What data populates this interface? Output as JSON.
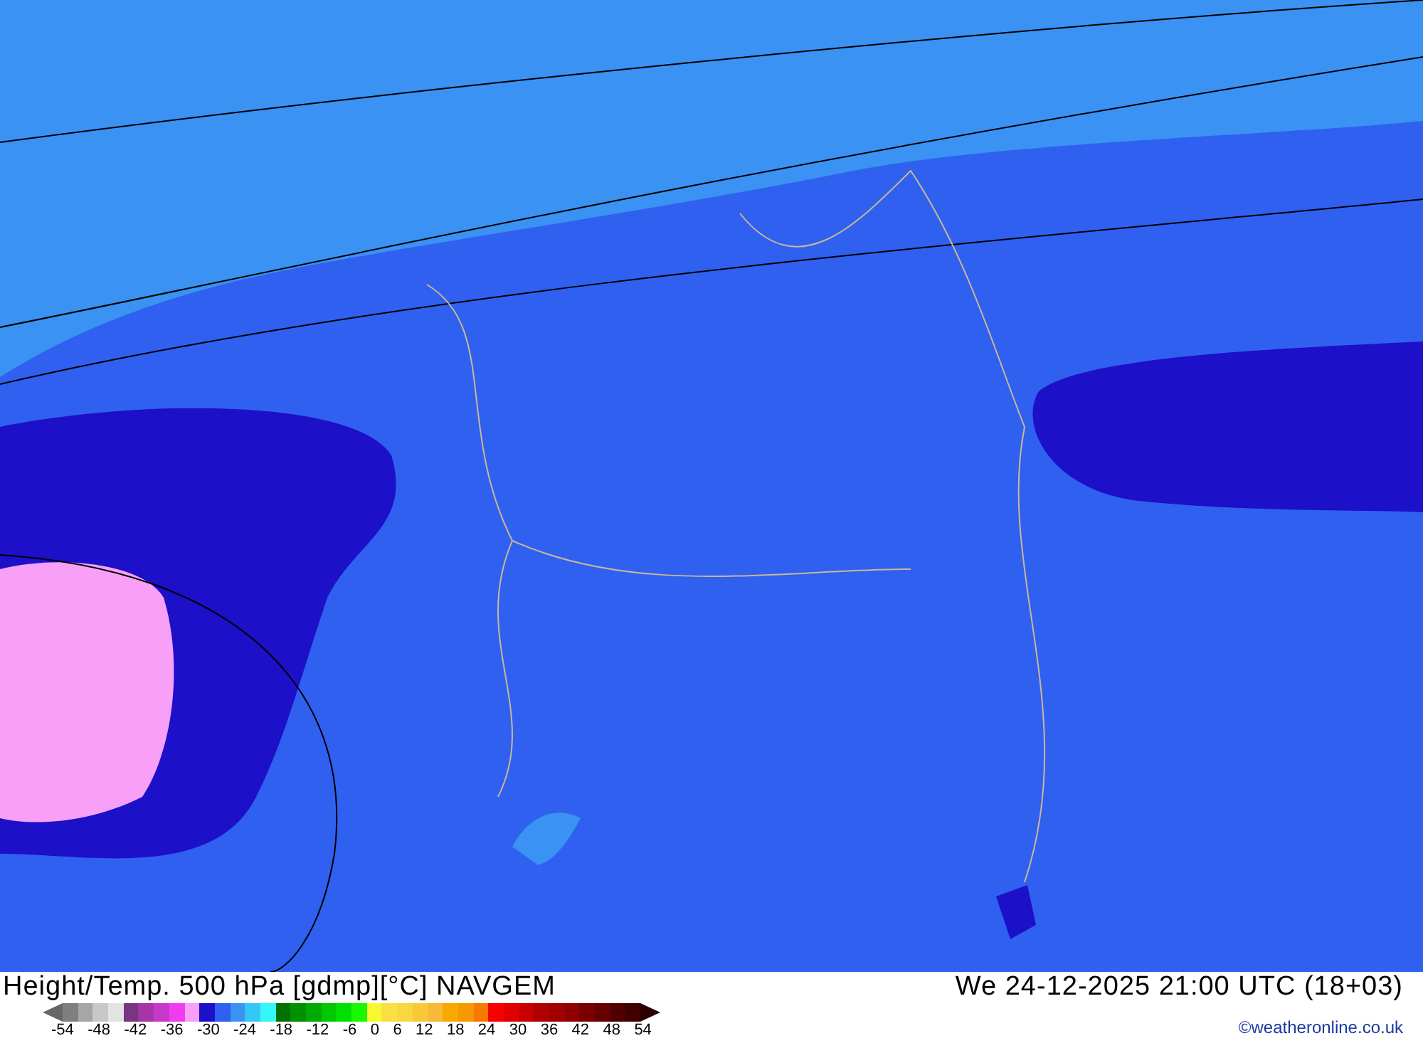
{
  "title": "Height/Temp. 500 hPa [gdmp][°C] NAVGEM",
  "valid_time": "We 24-12-2025 21:00 UTC (18+03)",
  "legend": {
    "swatches": [
      {
        "color": "#7f7f7f"
      },
      {
        "color": "#a6a6a6"
      },
      {
        "color": "#c8c8c8"
      },
      {
        "color": "#e3e3e3"
      },
      {
        "color": "#7a3580"
      },
      {
        "color": "#a535a8"
      },
      {
        "color": "#c838c8"
      },
      {
        "color": "#f03cf0"
      },
      {
        "color": "#f8a0f8"
      },
      {
        "color": "#1c10c8"
      },
      {
        "color": "#3060f0"
      },
      {
        "color": "#3a92f2"
      },
      {
        "color": "#34c8f8"
      },
      {
        "color": "#34f8f8"
      },
      {
        "color": "#007000"
      },
      {
        "color": "#009000"
      },
      {
        "color": "#00aa00"
      },
      {
        "color": "#00c800"
      },
      {
        "color": "#00e000"
      },
      {
        "color": "#18f800"
      },
      {
        "color": "#f8f830"
      },
      {
        "color": "#f8e040"
      },
      {
        "color": "#f8d840"
      },
      {
        "color": "#f8c838"
      },
      {
        "color": "#f8b838"
      },
      {
        "color": "#f8a800"
      },
      {
        "color": "#f89800"
      },
      {
        "color": "#f87800"
      },
      {
        "color": "#f80000"
      },
      {
        "color": "#e00000"
      },
      {
        "color": "#c80000"
      },
      {
        "color": "#b00000"
      },
      {
        "color": "#a00000"
      },
      {
        "color": "#900000"
      },
      {
        "color": "#780000"
      },
      {
        "color": "#640000"
      },
      {
        "color": "#500000"
      },
      {
        "color": "#400000"
      }
    ],
    "ticks": [
      "-54",
      "-48",
      "-42",
      "-36",
      "-30",
      "-24",
      "-18",
      "-12",
      "-6",
      "0",
      "6",
      "12",
      "18",
      "24",
      "30",
      "36",
      "42",
      "48",
      "54"
    ]
  },
  "copyright": "©weatheronline.co.uk"
}
